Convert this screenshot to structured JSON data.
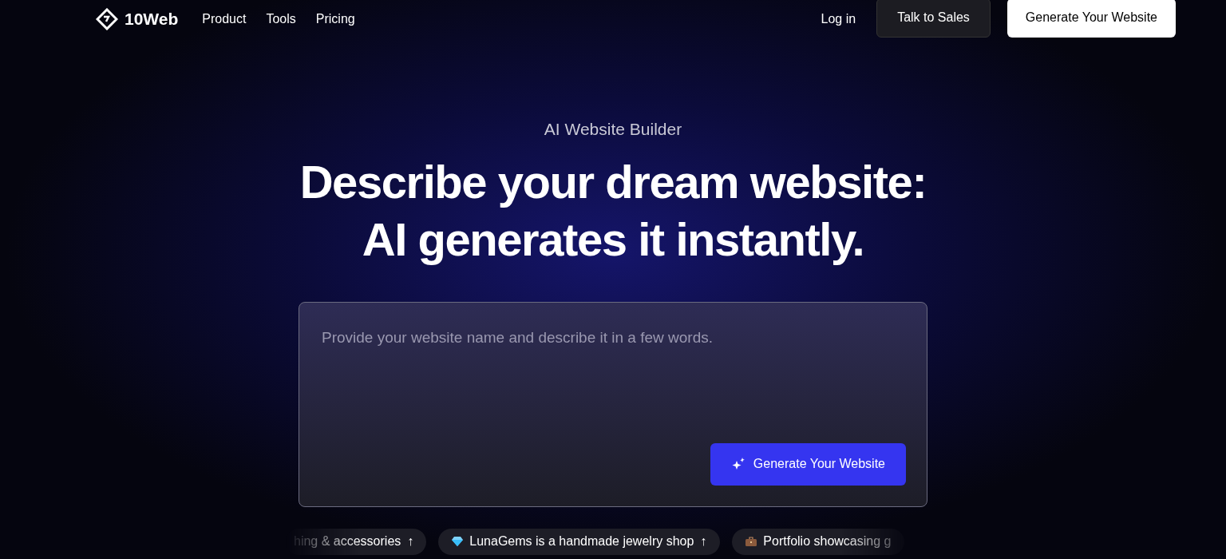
{
  "nav": {
    "logo": "10Web",
    "links": [
      "Product",
      "Tools",
      "Pricing"
    ],
    "login": "Log in",
    "sales": "Talk to Sales",
    "cta": "Generate Your Website"
  },
  "hero": {
    "eyebrow": "AI Website Builder",
    "title_lines": [
      "Describe your dream website:",
      "AI generates it instantly."
    ]
  },
  "prompt": {
    "placeholder": "Provide your website name and describe it in a few words.",
    "button": "Generate Your Website"
  },
  "suggestions": [
    {
      "kind": "plain",
      "text": "hing & accessories",
      "arrow": "↑"
    },
    {
      "kind": "gem",
      "text": "LunaGems is a handmade jewelry shop",
      "arrow": "↑"
    },
    {
      "kind": "briefcase",
      "text": "Portfolio showcasing g"
    }
  ]
}
